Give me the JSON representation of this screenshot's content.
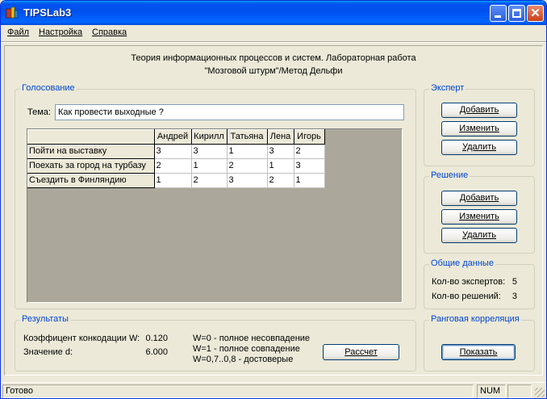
{
  "window": {
    "title": "TIPSLab3"
  },
  "menu": {
    "file": "Файл",
    "settings": "Настройка",
    "help": "Справка"
  },
  "header": {
    "line1": "Теория информационных процессов и систем. Лабораторная работа",
    "line2": "\"Мозговой штурм\"/Метод Дельфи"
  },
  "voting": {
    "legend": "Голосование",
    "topic_label": "Тема:",
    "topic_value": "Как провести выходные ?",
    "columns": [
      "Андрей",
      "Кирилл",
      "Татьяна",
      "Лена",
      "Игорь"
    ],
    "rows": [
      {
        "label": "Пойти на выставку",
        "values": [
          "3",
          "3",
          "1",
          "3",
          "2"
        ]
      },
      {
        "label": "Поехать за город на турбазу",
        "values": [
          "2",
          "1",
          "2",
          "1",
          "3"
        ]
      },
      {
        "label": "Съездить в Финляндию",
        "values": [
          "1",
          "2",
          "3",
          "2",
          "1"
        ]
      }
    ]
  },
  "expert": {
    "legend": "Эксперт",
    "add": "Добавить",
    "edit": "Изменить",
    "delete": "Удалить"
  },
  "decision": {
    "legend": "Решение",
    "add": "Добавить",
    "edit": "Изменить",
    "delete": "Удалить"
  },
  "general": {
    "legend": "Общие данные",
    "experts_label": "Кол-во экспертов:",
    "experts_value": "5",
    "decisions_label": "Кол-во решений:",
    "decisions_value": "3"
  },
  "results": {
    "legend": "Результаты",
    "concordance_label": "Коэффицент конкодации W:",
    "concordance_value": "0.120",
    "d_label": "Значение d:",
    "d_value": "6.000",
    "note1": "W=0 - полное несовпадение",
    "note2": "W=1 - полное совпадение",
    "note3": "W=0,7..0,8 - достоверые",
    "calc_button": "Рассчет"
  },
  "rank": {
    "legend": "Ранговая корреляция",
    "show_button": "Показать"
  },
  "status": {
    "text": "Готово",
    "num": "NUM"
  }
}
